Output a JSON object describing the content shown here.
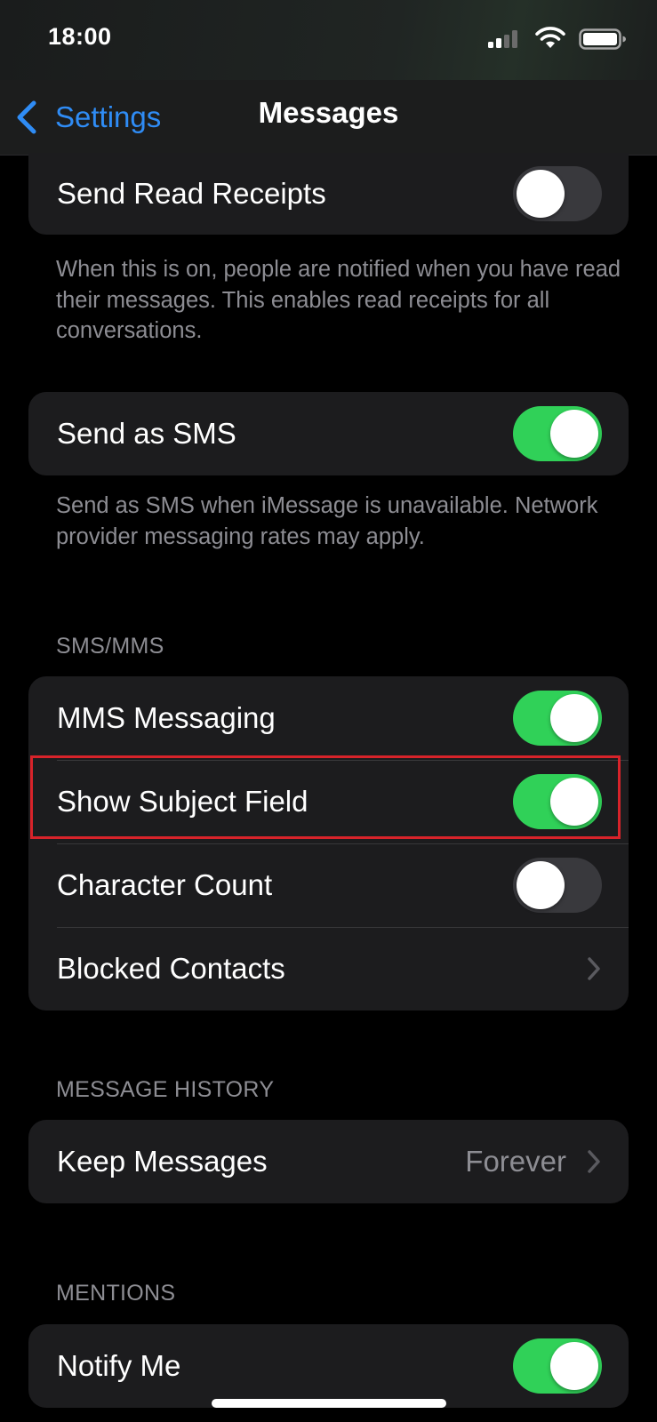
{
  "status_bar": {
    "time": "18:00",
    "icons": [
      "cellular-signal-icon",
      "wifi-icon",
      "battery-icon"
    ]
  },
  "nav": {
    "back_label": "Settings",
    "title": "Messages"
  },
  "groups": {
    "read_receipts": {
      "label": "Send Read Receipts",
      "on": false,
      "footer": "When this is on, people are notified when you have read their messages. This enables read receipts for all conversations."
    },
    "send_sms": {
      "label": "Send as SMS",
      "on": true,
      "footer": "Send as SMS when iMessage is unavailable. Network provider messaging rates may apply."
    },
    "sms_mms": {
      "header": "SMS/MMS",
      "mms_messaging": {
        "label": "MMS Messaging",
        "on": true
      },
      "show_subject_field": {
        "label": "Show Subject Field",
        "on": true
      },
      "character_count": {
        "label": "Character Count",
        "on": false
      },
      "blocked_contacts": {
        "label": "Blocked Contacts"
      }
    },
    "message_history": {
      "header": "MESSAGE HISTORY",
      "keep_messages": {
        "label": "Keep Messages",
        "value": "Forever"
      }
    },
    "mentions": {
      "header": "MENTIONS",
      "notify_me": {
        "label": "Notify Me",
        "on": true
      }
    }
  },
  "colors": {
    "accent_blue": "#2f8cf5",
    "toggle_on": "#30d158",
    "toggle_off": "#39393d",
    "highlight": "#d8232a",
    "secondary_text": "#8d8d93",
    "cell_background": "#1c1c1e"
  }
}
